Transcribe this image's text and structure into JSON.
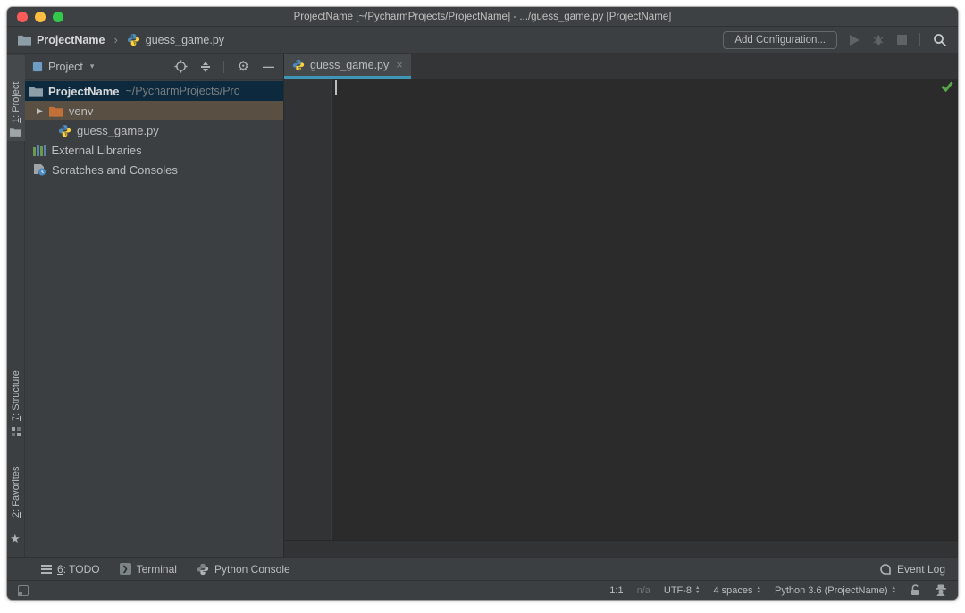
{
  "titlebar": {
    "title": "ProjectName [~/PycharmProjects/ProjectName] - .../guess_game.py [ProjectName]"
  },
  "navbar": {
    "project_crumb": "ProjectName",
    "file_crumb": "guess_game.py",
    "add_configuration": "Add Configuration..."
  },
  "glyphs": {
    "breadcrumb_separator": "›",
    "dropdown_caret": "▾",
    "tab_close": "×",
    "expand_arrow": "▶",
    "star": "★",
    "gear": "⚙",
    "minus": "—",
    "terminal_chevron": "❯",
    "sort_up": "▲",
    "sort_down": "▼"
  },
  "stripe": {
    "project_num": "1",
    "project_rest": ": Project",
    "structure_num": "7",
    "structure_rest": ": Structure",
    "favorites_num": "2",
    "favorites_rest": ": Favorites"
  },
  "project_panel": {
    "title": "Project",
    "tree": {
      "root": {
        "name": "ProjectName",
        "path": "~/PycharmProjects/Pro"
      },
      "venv": {
        "name": "venv"
      },
      "file": {
        "name": "guess_game.py"
      },
      "external": {
        "name": "External Libraries"
      },
      "scratches": {
        "name": "Scratches and Consoles"
      }
    }
  },
  "editor": {
    "tab_label": "guess_game.py"
  },
  "bottom_bar": {
    "todo_num": "6",
    "todo_rest": ": TODO",
    "terminal": "Terminal",
    "python_console": "Python Console",
    "event_log": "Event Log"
  },
  "statusbar": {
    "caret_position": "1:1",
    "line_separator": "n/a",
    "encoding": "UTF-8",
    "indent": "4 spaces",
    "interpreter": "Python 3.6 (ProjectName)"
  },
  "colors": {
    "editor_bg": "#2B2B2B",
    "panel_bg": "#3C3F41",
    "tree_selection": "#0D293E",
    "tree_hover": "#594F42",
    "tab_underline": "#3F96B6",
    "folder_gray": "#8E9EA8",
    "folder_orange": "#C2703A",
    "python_blue": "#4B8BBE",
    "python_yellow": "#FFD43B",
    "check_green": "#57A64A",
    "traffic_red": "#FC5B57",
    "traffic_yellow": "#FDBE41",
    "traffic_green": "#34C84A"
  }
}
